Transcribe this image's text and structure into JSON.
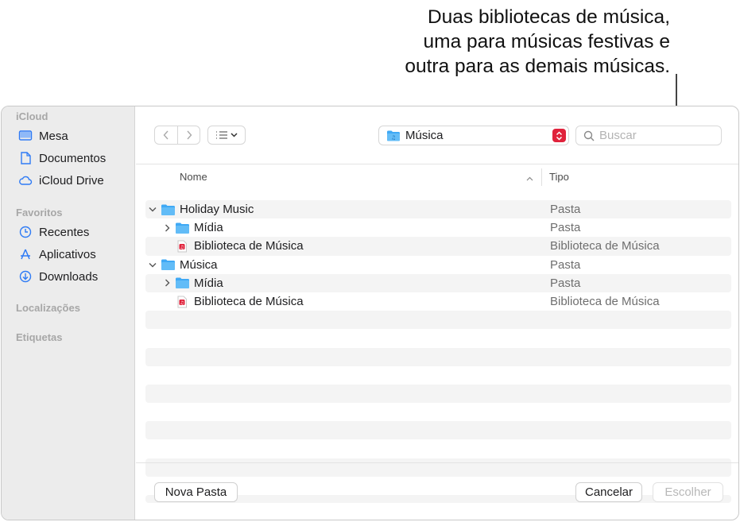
{
  "callout": {
    "lines": [
      "Duas bibliotecas de música,",
      "uma para músicas festivas e",
      "outra para as demais músicas."
    ]
  },
  "sidebar": {
    "sections": [
      {
        "title": "iCloud",
        "items": [
          {
            "label": "Mesa",
            "icon": "desktop-icon"
          },
          {
            "label": "Documentos",
            "icon": "document-icon"
          },
          {
            "label": "iCloud Drive",
            "icon": "cloud-icon"
          }
        ]
      },
      {
        "title": "Favoritos",
        "items": [
          {
            "label": "Recentes",
            "icon": "clock-icon"
          },
          {
            "label": "Aplicativos",
            "icon": "apps-icon"
          },
          {
            "label": "Downloads",
            "icon": "download-icon"
          }
        ]
      },
      {
        "title": "Localizações",
        "items": []
      },
      {
        "title": "Etiquetas",
        "items": []
      }
    ]
  },
  "toolbar": {
    "location": "Música",
    "search_placeholder": "Buscar"
  },
  "columns": {
    "name": "Nome",
    "kind": "Tipo"
  },
  "rows": [
    {
      "name": "Holiday Music",
      "kind": "Pasta",
      "level": 0,
      "disclosure": "expanded",
      "icon": "folder-icon"
    },
    {
      "name": "Mídia",
      "kind": "Pasta",
      "level": 1,
      "disclosure": "collapsed",
      "icon": "folder-icon"
    },
    {
      "name": "Biblioteca de Música",
      "kind": "Biblioteca de Música",
      "level": 1,
      "disclosure": "none",
      "icon": "music-library-icon"
    },
    {
      "name": "Música",
      "kind": "Pasta",
      "level": 0,
      "disclosure": "expanded",
      "icon": "folder-icon"
    },
    {
      "name": "Mídia",
      "kind": "Pasta",
      "level": 1,
      "disclosure": "collapsed",
      "icon": "folder-icon"
    },
    {
      "name": "Biblioteca de Música",
      "kind": "Biblioteca de Música",
      "level": 1,
      "disclosure": "none",
      "icon": "music-library-icon"
    }
  ],
  "buttons": {
    "new_folder": "Nova Pasta",
    "cancel": "Cancelar",
    "choose": "Escolher"
  },
  "colors": {
    "folder": "#3fa9f5",
    "accent_red": "#e0223b"
  }
}
